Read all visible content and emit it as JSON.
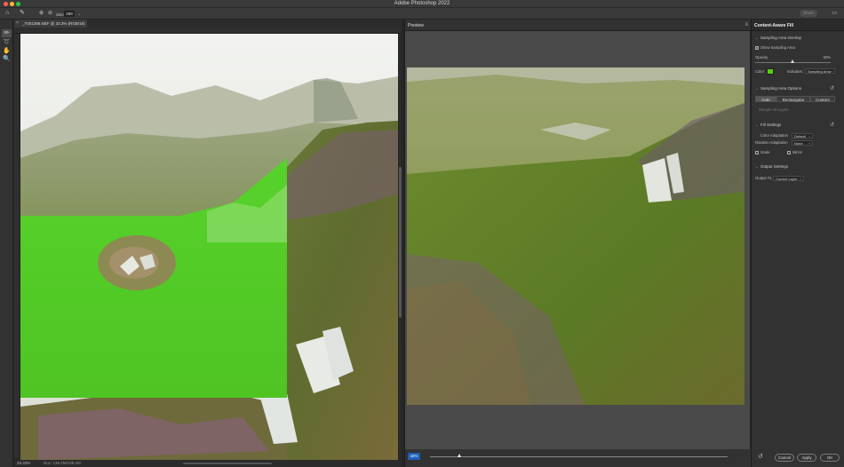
{
  "app": {
    "title": "Adobe Photoshop 2022"
  },
  "options": {
    "size_label": "Size:",
    "size_value": "288",
    "share_label": "Share"
  },
  "document": {
    "tab_label": "_T001396.NEF @ 33.3% (RGB/16) *",
    "zoom": "33.33%",
    "doc_info": "Doc: 138.2M/138.2M"
  },
  "preview": {
    "tab_label": "Preview",
    "zoom": "42%",
    "zoom_fraction": 0.1
  },
  "panel": {
    "title": "Content-Aware Fill",
    "sampling_overlay": {
      "header": "Sampling Area Overlay",
      "show_sampling_label": "Show Sampling Area",
      "show_sampling_checked": true,
      "opacity_label": "Opacity",
      "opacity_value": "50%",
      "opacity_fraction": 0.5,
      "color_label": "Color",
      "color_value": "#58d10f",
      "indicates_label": "Indicates:",
      "indicates_value": "Sampling Area"
    },
    "sampling_options": {
      "header": "Sampling Area Options",
      "buttons": [
        "Auto",
        "Rectangular",
        "Custom"
      ],
      "selected": "Auto",
      "all_layers_label": "Sample All Layers"
    },
    "fill_settings": {
      "header": "Fill Settings",
      "color_adaptation_label": "Color Adaptation",
      "color_adaptation_value": "Default",
      "rotation_adaptation_label": "Rotation Adaptation",
      "rotation_adaptation_value": "None",
      "scale_label": "Scale",
      "mirror_label": "Mirror"
    },
    "output": {
      "header": "Output Settings",
      "output_to_label": "Output To:",
      "output_to_value": "Current Layer"
    },
    "footer": {
      "cancel": "Cancel",
      "apply": "Apply",
      "ok": "OK"
    }
  },
  "icons": [
    "home-icon",
    "brush-icon",
    "lasso-icon",
    "hand-icon",
    "zoom-icon",
    "reset-icon",
    "menu-icon",
    "close-icon"
  ]
}
